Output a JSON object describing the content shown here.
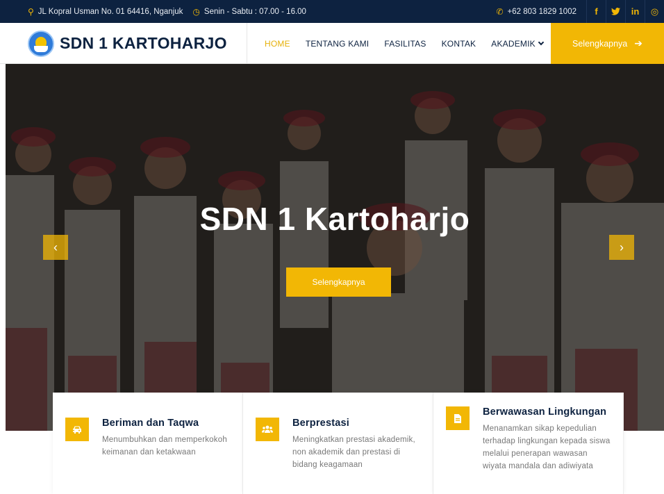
{
  "topbar": {
    "address": "JL Kopral Usman No. 01 64416, Nganjuk",
    "hours": "Senin - Sabtu : 07.00 - 16.00",
    "phone": "+62 803 1829 1002",
    "social": [
      {
        "icon": "facebook-icon",
        "glyph": "f"
      },
      {
        "icon": "twitter-icon",
        "glyph": "🐦"
      },
      {
        "icon": "linkedin-icon",
        "glyph": "in"
      },
      {
        "icon": "instagram-icon",
        "glyph": "◎"
      }
    ]
  },
  "header": {
    "brand": "SDN 1 KARTOHARJO",
    "nav": [
      {
        "label": "HOME",
        "active": true
      },
      {
        "label": "TENTANG KAMI",
        "active": false
      },
      {
        "label": "FASILITAS",
        "active": false
      },
      {
        "label": "KONTAK",
        "active": false
      },
      {
        "label": "AKADEMIK",
        "active": false,
        "dropdown": true
      }
    ],
    "cta_label": "Selengkapnya",
    "cta_arrow": "➔"
  },
  "hero": {
    "title": "SDN 1 Kartoharjo",
    "button_label": "Selengkapnya",
    "prev_glyph": "‹",
    "next_glyph": "›"
  },
  "features": [
    {
      "icon": "car-icon",
      "glyph": "🚘",
      "title": "Beriman dan Taqwa",
      "text": "Menumbuhkan dan memperkokoh keimanan dan ketakwaan"
    },
    {
      "icon": "users-icon",
      "glyph": "👥",
      "title": "Berprestasi",
      "text": "Meningkatkan prestasi akademik, non akademik dan prestasi di bidang keagamaan"
    },
    {
      "icon": "document-icon",
      "glyph": "▤",
      "title": "Berwawasan Lingkungan",
      "text": "Menanamkan sikap kepedulian terhadap lingkungan kepada siswa melalui penerapan wawasan wiyata mandala dan adiwiyata"
    }
  ],
  "colors": {
    "navy": "#0d2240",
    "accent": "#f2b705"
  }
}
